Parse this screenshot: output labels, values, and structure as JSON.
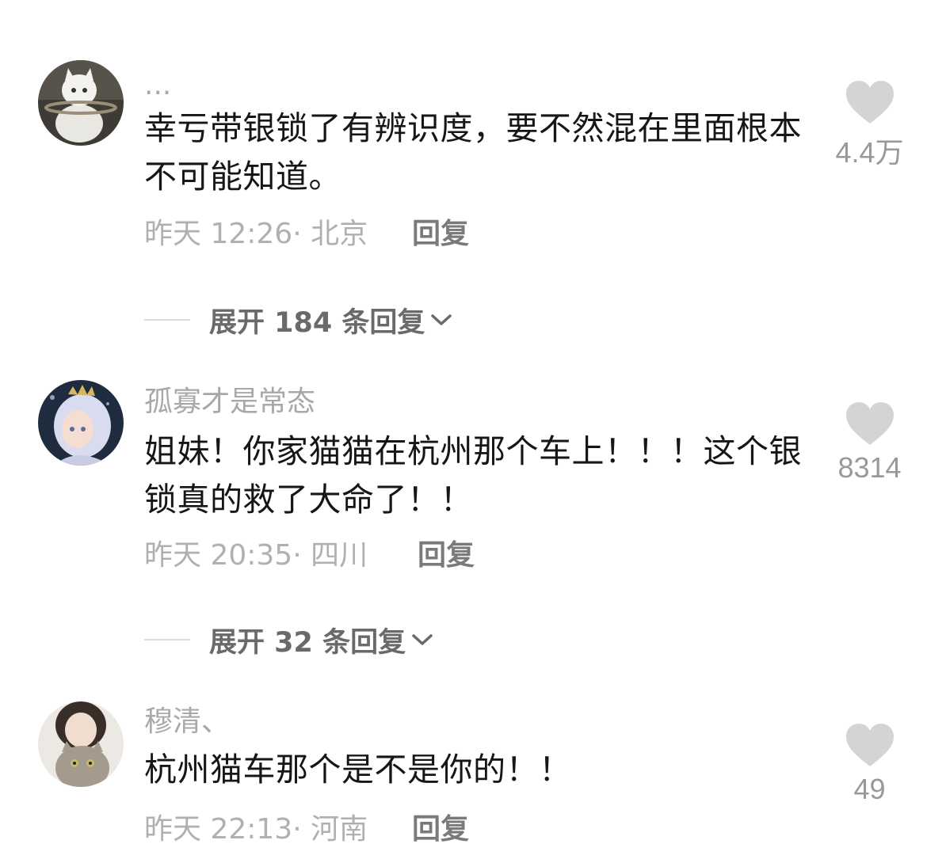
{
  "comments": [
    {
      "username": "...",
      "text": "幸亏带银锁了有辨识度，要不然混在里面根本不可能知道。",
      "time": "昨天 12:26",
      "location": "北京",
      "reply_label": "回复",
      "likes": "4.4万",
      "expand_label": "展开 184 条回复"
    },
    {
      "username": "孤寡才是常态",
      "text": "姐妹！你家猫猫在杭州那个车上！！！这个银锁真的救了大命了！！",
      "time": "昨天 20:35",
      "location": "四川",
      "reply_label": "回复",
      "likes": "8314",
      "expand_label": "展开 32 条回复"
    },
    {
      "username": "穆清、",
      "text": "杭州猫车那个是不是你的！！",
      "time": "昨天 22:13",
      "location": "河南",
      "reply_label": "回复",
      "likes": "49"
    }
  ],
  "icons": {
    "like": "heart-icon",
    "expand": "chevron-down-icon"
  },
  "colors": {
    "text": "#161616",
    "muted": "#b0b0b0",
    "heart": "#d4d4d4"
  }
}
